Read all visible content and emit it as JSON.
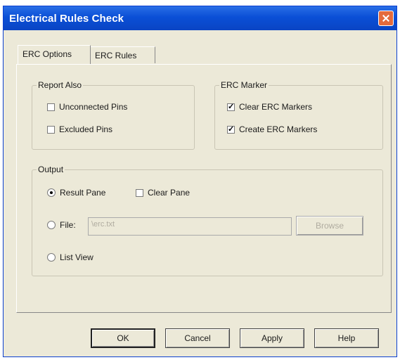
{
  "window": {
    "title": "Electrical Rules Check"
  },
  "tabs": [
    {
      "label": "ERC Options"
    },
    {
      "label": "ERC Rules"
    }
  ],
  "report_also": {
    "label": "Report Also",
    "unconnected_pins": {
      "label": "Unconnected Pins",
      "checked": false
    },
    "excluded_pins": {
      "label": "Excluded Pins",
      "checked": false
    }
  },
  "erc_marker": {
    "label": "ERC Marker",
    "clear": {
      "label": "Clear ERC Markers",
      "checked": true
    },
    "create": {
      "label": "Create ERC Markers",
      "checked": true
    }
  },
  "output": {
    "label": "Output",
    "result_pane": {
      "label": "Result Pane",
      "selected": true
    },
    "clear_pane": {
      "label": "Clear Pane",
      "checked": false
    },
    "file": {
      "label": "File:",
      "value": "\\erc.txt",
      "selected": false
    },
    "browse": {
      "label": "Browse"
    },
    "list_view": {
      "label": "List View",
      "selected": false
    }
  },
  "buttons": {
    "ok": "OK",
    "cancel": "Cancel",
    "apply": "Apply",
    "help": "Help"
  }
}
